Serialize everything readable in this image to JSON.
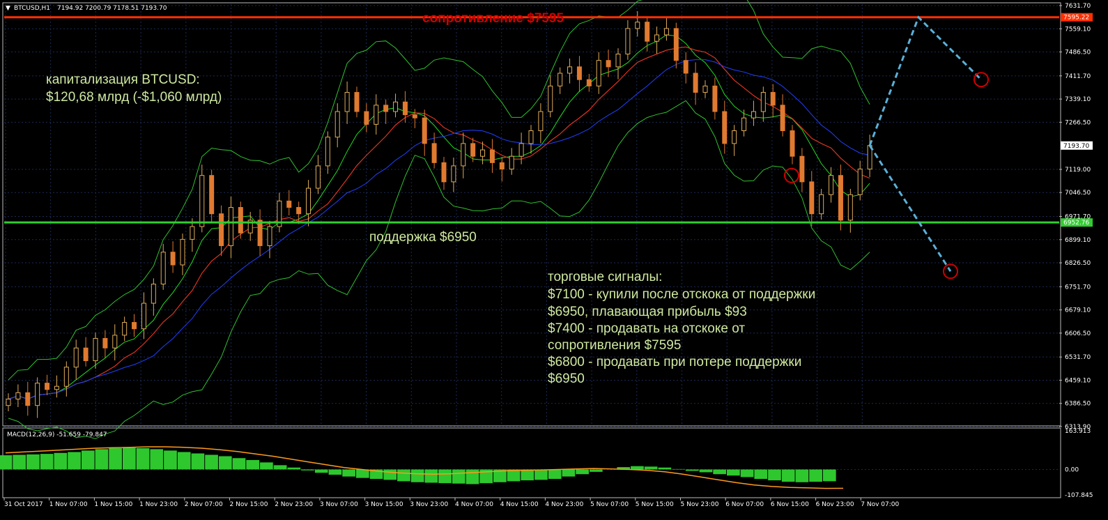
{
  "chart_data": [
    {
      "type": "candlestick",
      "symbol": "BTCUSD,H1",
      "header_values": "7194.92 7200.79 7178.51 7193.70",
      "current_price": "7193.70",
      "y_ticks": [
        "7631.70",
        "7559.10",
        "7486.50",
        "7411.70",
        "7339.10",
        "7266.50",
        "7119.00",
        "7046.50",
        "6971.70",
        "6899.10",
        "6826.50",
        "6751.70",
        "6679.10",
        "6606.50",
        "6531.70",
        "6459.10",
        "6386.50",
        "6313.90"
      ],
      "x_ticks": [
        "31 Oct 2017",
        "1 Nov 07:00",
        "1 Nov 15:00",
        "1 Nov 23:00",
        "2 Nov 07:00",
        "2 Nov 15:00",
        "2 Nov 23:00",
        "3 Nov 07:00",
        "3 Nov 15:00",
        "3 Nov 23:00",
        "4 Nov 07:00",
        "4 Nov 15:00",
        "4 Nov 23:00",
        "5 Nov 07:00",
        "5 Nov 15:00",
        "5 Nov 23:00",
        "6 Nov 07:00",
        "6 Nov 15:00",
        "6 Nov 23:00",
        "7 Nov 07:00"
      ],
      "levels": [
        {
          "name": "resistance",
          "value": 7595.22,
          "label": "7595.22",
          "color": "#ff3000"
        },
        {
          "name": "support",
          "value": 6952.76,
          "label": "6952.76",
          "color": "#33cc33"
        }
      ],
      "close_prices": [
        6400,
        6420,
        6380,
        6450,
        6430,
        6440,
        6500,
        6560,
        6520,
        6590,
        6560,
        6600,
        6640,
        6620,
        6700,
        6760,
        6860,
        6820,
        6900,
        6940,
        7100,
        6980,
        6880,
        7000,
        6920,
        6960,
        6880,
        6940,
        7020,
        7000,
        6980,
        7060,
        7130,
        7220,
        7300,
        7360,
        7300,
        7260,
        7320,
        7300,
        7330,
        7290,
        7280,
        7200,
        7140,
        7080,
        7130,
        7200,
        7160,
        7180,
        7140,
        7120,
        7160,
        7200,
        7240,
        7300,
        7380,
        7420,
        7440,
        7400,
        7380,
        7460,
        7440,
        7480,
        7560,
        7580,
        7520,
        7540,
        7560,
        7460,
        7420,
        7360,
        7380,
        7300,
        7200,
        7240,
        7280,
        7300,
        7360,
        7320,
        7240,
        7160,
        7080,
        6980,
        7040,
        7100,
        6960,
        7040,
        7120,
        7193.7
      ],
      "forecast_path": [
        {
          "x": "7 Nov 07:00",
          "y": 7193.7
        },
        {
          "y": 7595
        },
        {
          "y": 7400
        }
      ],
      "forecast_path_down": [
        {
          "x": "7 Nov 07:00",
          "y": 7193.7
        },
        {
          "y": 6800
        }
      ],
      "signal_circles": [
        7100,
        7400,
        6800
      ],
      "colors": {
        "bull": "#e0ad5a",
        "bear": "#e07a30",
        "ma_red": "#ff2020",
        "ma_blue": "#2040ff",
        "ma_green": "#22dd22",
        "bands": "#30c030",
        "forecast": "#5ab0d8",
        "grid": "#1b2a55"
      }
    },
    {
      "type": "bar",
      "name": "MACD(12,26,9) -51.659 -79.847",
      "y_ticks": [
        "163.913",
        "0.00",
        "-107.845"
      ],
      "ylim": [
        -107.845,
        163.913
      ],
      "histogram": [
        60,
        62,
        64,
        66,
        70,
        74,
        80,
        86,
        90,
        92,
        90,
        86,
        80,
        74,
        68,
        62,
        56,
        48,
        40,
        30,
        18,
        8,
        -4,
        -14,
        -22,
        -30,
        -36,
        -40,
        -44,
        -50,
        -54,
        -56,
        -58,
        -60,
        -62,
        -58,
        -54,
        -50,
        -46,
        -44,
        -40,
        -30,
        -20,
        -10,
        0,
        10,
        14,
        12,
        8,
        2,
        -6,
        -12,
        -20,
        -26,
        -32,
        -40,
        -46,
        -52,
        -54,
        -52,
        -50
      ],
      "signal": [
        70,
        74,
        78,
        82,
        86,
        90,
        92,
        94,
        96,
        96,
        94,
        90,
        84,
        76,
        66,
        56,
        44,
        32,
        20,
        8,
        0,
        -8,
        -14,
        -18,
        -20,
        -18,
        -14,
        -10,
        -6,
        -4,
        -2,
        0,
        2,
        4,
        2,
        0,
        -4,
        -10,
        -20,
        -32,
        -44,
        -56,
        -66,
        -72,
        -76,
        -78,
        -80,
        -79.847
      ],
      "colors": {
        "hist": "#2ec82e",
        "signal": "#ff9a1e"
      }
    }
  ],
  "annotations": {
    "resistance": "сопротивление $7595",
    "support": "поддержка $6950",
    "cap_line1": "капитализация BTCUSD:",
    "cap_line2": "$120,68 млрд (-$1,060 млрд)",
    "signals": [
      "торговые сигналы:",
      "$7100 - купили после отскока от поддержки",
      "$6950, плавающая прибыль $93",
      "$7400 - продавать на отскоке от",
      "сопротивления $7595",
      "$6800 - продавать при потере поддержки",
      "$6950"
    ]
  }
}
